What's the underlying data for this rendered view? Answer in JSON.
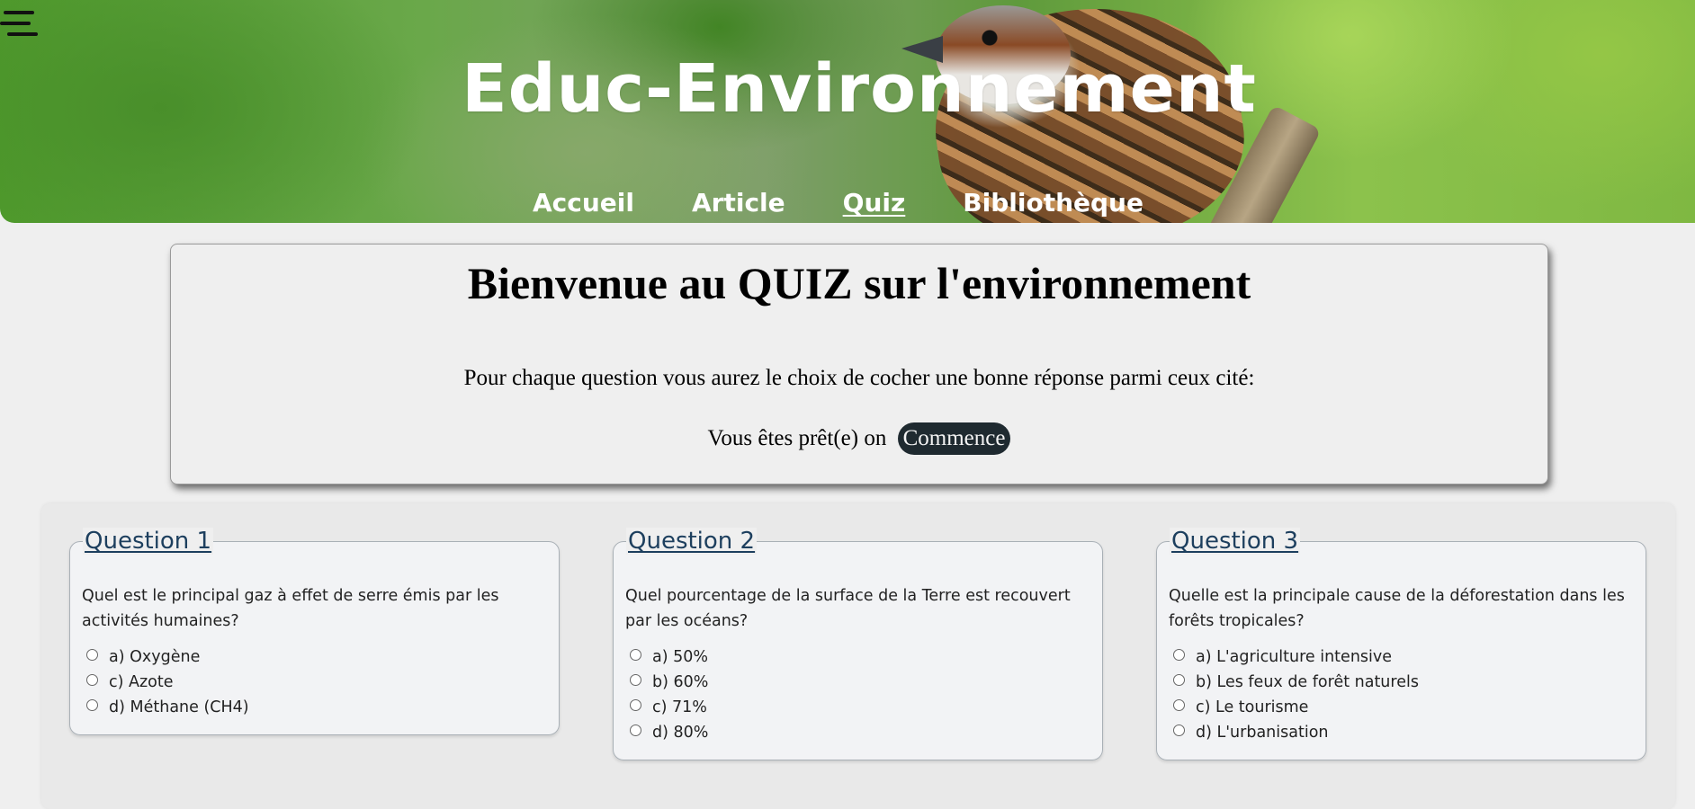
{
  "header": {
    "title": "Educ-Environnement",
    "nav": [
      {
        "label": "Accueil"
      },
      {
        "label": "Article"
      },
      {
        "label": "Quiz",
        "active": true
      },
      {
        "label": "Bibliothèque"
      }
    ]
  },
  "intro": {
    "heading": "Bienvenue au QUIZ sur l'environnement",
    "description": "Pour chaque question vous aurez le choix de cocher une bonne réponse parmi ceux cité:",
    "ready_text": "Vous êtes prêt(e) on",
    "start_button": "Commence"
  },
  "questions": [
    {
      "legend": "Question 1",
      "text": "Quel est le principal gaz à effet de serre émis par les activités humaines?",
      "options": [
        "a) Oxygène",
        "c) Azote",
        "d) Méthane (CH4)"
      ]
    },
    {
      "legend": "Question 2",
      "text": "Quel pourcentage de la surface de la Terre est recouvert par les océans?",
      "options": [
        "a) 50%",
        "b) 60%",
        "c) 71%",
        "d) 80%"
      ]
    },
    {
      "legend": "Question 3",
      "text": "Quelle est la principale cause de la déforestation dans les forêts tropicales?",
      "options": [
        "a) L'agriculture intensive",
        "b) Les feux de forêt naturels",
        "c) Le tourisme",
        "d) L'urbanisation"
      ]
    }
  ]
}
